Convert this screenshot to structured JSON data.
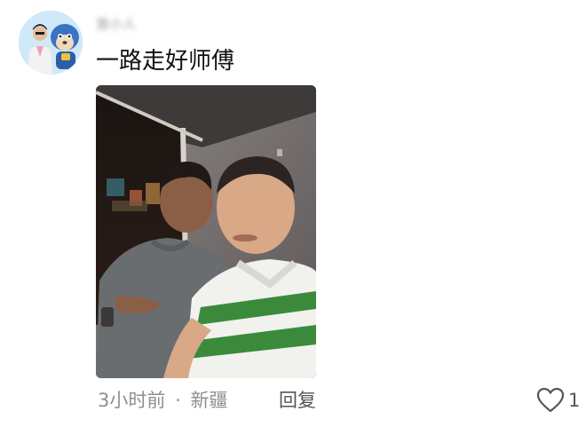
{
  "comment": {
    "username": "曾小人",
    "text": "一路走好师傅",
    "time": "3小时前",
    "separator": "·",
    "location": "新疆",
    "reply_label": "回复",
    "like_count": "1"
  },
  "icons": {
    "like": "heart-outline-icon"
  },
  "colors": {
    "text_primary": "#111111",
    "text_meta": "#8f8f8f",
    "text_action": "#555555",
    "background": "#ffffff"
  }
}
